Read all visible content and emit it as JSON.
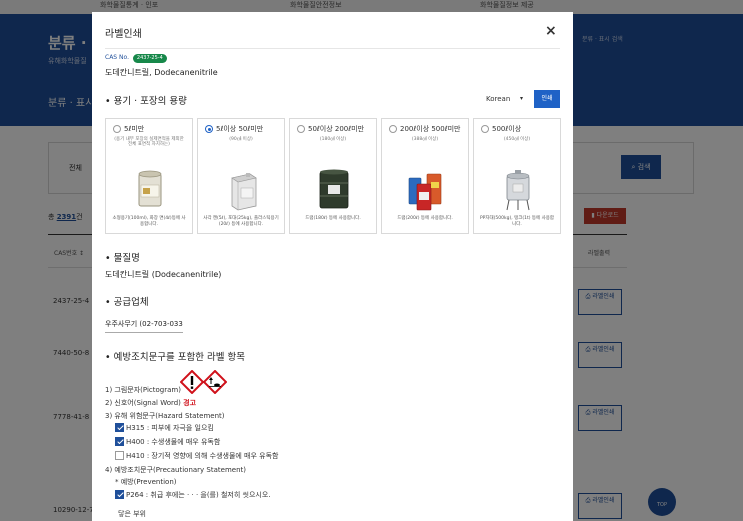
{
  "background": {
    "top_nav": [
      "화학물질통계 · 인포",
      "화학물질안전정보",
      "화학물질정보 제공"
    ],
    "hero_title": "분류 · 표",
    "hero_subtitle": "유해화학물질",
    "hero_tab": "분류 · 표시",
    "breadcrumb": "분류 · 표시 검색",
    "search_label": "전체",
    "search_button": "검색",
    "count_prefix": "총",
    "count_value": "2391",
    "count_suffix": "건",
    "download_button": "다운로드",
    "col_cas": "CAS번호 ↕",
    "col_label": "라벨출력",
    "rows": [
      "2437-25-4",
      "7440-50-8",
      "7778-41-8",
      "10290-12-7"
    ],
    "label_button": "라벨인쇄",
    "top_button": "TOP"
  },
  "modal": {
    "title": "라벨인쇄",
    "close": "×",
    "cas_prefix": "CAS No.",
    "cas_no": "2437-25-4",
    "substance_name": "도데칸니트릴, Dodecanenitrile",
    "container_section": "용기 · 포장의 용량",
    "language": "Korean",
    "print_button": "인쇄",
    "options": [
      {
        "label": "5ℓ미만",
        "sub": "(용기 내부 포장의 실제면적을 제외한 전체 표면적 자치하는)",
        "desc": "소형용기(100ml), 화장 면(4ℓ)등에 사용합니다.",
        "selected": false
      },
      {
        "label": "5ℓ이상 50ℓ미만",
        "sub": "(90㎠ 이상)",
        "desc": "사각 캔(5ℓ), 포대(25kg), 플라스틱용기(20ℓ) 등에 사용합니다.",
        "selected": true
      },
      {
        "label": "50ℓ이상 200ℓ미만",
        "sub": "(180㎠ 이상)",
        "desc": "드럼(180ℓ) 등에 사용합니다.",
        "selected": false
      },
      {
        "label": "200ℓ이상 500ℓ미만",
        "sub": "(388㎠ 이상)",
        "desc": "드럼(200ℓ) 등에 사용합니다.",
        "selected": false
      },
      {
        "label": "500ℓ이상",
        "sub": "(450㎠ 이상)",
        "desc": "PP자대(500kg), 탱크(1t) 등에 사용합니다.",
        "selected": false
      }
    ],
    "substance_section": "물질명",
    "substance_full": "도데칸니트릴 (Dodecanenitrile)",
    "supplier_section": "공급업체",
    "supplier_value": "우주사무기 (02-703-0332",
    "label_section": "예방조치문구를 포함한 라벨 항목",
    "pictogram_label": "1) 그림문자(Pictogram)",
    "signal_label": "2) 신호어(Signal Word)",
    "signal_word": "경고",
    "hazard_label": "3) 유해 위험문구(Hazard Statement)",
    "hazards": [
      {
        "text": "H315 : 피부에 자극을 일으킴",
        "checked": true
      },
      {
        "text": "H400 : 수생생물에 매우 유독함",
        "checked": true
      },
      {
        "text": "H410 : 장기적 영향에 의해 수생생물에 매우 유독함",
        "checked": false
      }
    ],
    "precaution_label": "4) 예방조치문구(Precautionary Statement)",
    "prevention_label": "* 예방(Prevention)",
    "precautions": [
      {
        "text": "P264 : 취급 후에는 · · · 을(를) 철저히 씻으시오.",
        "checked": true
      }
    ],
    "next_text": "닿은 부위"
  },
  "colors": {
    "brand_blue": "#1f4f9a",
    "print_blue": "#1f62c6",
    "badge_green": "#17884a",
    "warning_red": "#d0111b"
  }
}
